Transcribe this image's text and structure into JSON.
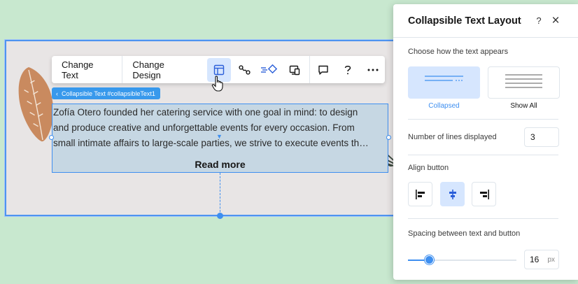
{
  "toolbar": {
    "change_text": "Change Text",
    "change_design": "Change Design",
    "icons": [
      "layout-icon",
      "animation-icon",
      "connect-icon",
      "layout-responsive-icon",
      "comment-icon",
      "help-icon",
      "more-icon"
    ]
  },
  "breadcrumb": {
    "label": "Collapsible Text #collapsibleText1"
  },
  "text_element": {
    "lines": [
      "Zofía Otero founded her catering service with one goal in mind: to design",
      "and produce creative and unforgettable events for every occasion. From",
      "small intimate affairs to large-scale parties, we strive to execute events th…"
    ],
    "read_more": "Read more"
  },
  "panel": {
    "title": "Collapsible Text Layout",
    "help_glyph": "?",
    "close_glyph": "×",
    "appearance_label": "Choose how the text appears",
    "options": [
      {
        "label": "Collapsed",
        "selected": true
      },
      {
        "label": "Show All",
        "selected": false
      }
    ],
    "lines_label": "Number of lines displayed",
    "lines_value": "3",
    "align_label": "Align button",
    "align_options": [
      "align-left-icon",
      "align-center-icon",
      "align-right-icon"
    ],
    "align_selected": "center",
    "spacing_label": "Spacing between text and button",
    "spacing_value": "16",
    "spacing_unit": "px"
  },
  "colors": {
    "accent": "#3e8ff0",
    "accent_light": "#d6e6fe",
    "canvas_bg": "#e8e5e5",
    "page_bg": "#c8e8cf",
    "text_selected_bg": "#c6d7e3"
  }
}
